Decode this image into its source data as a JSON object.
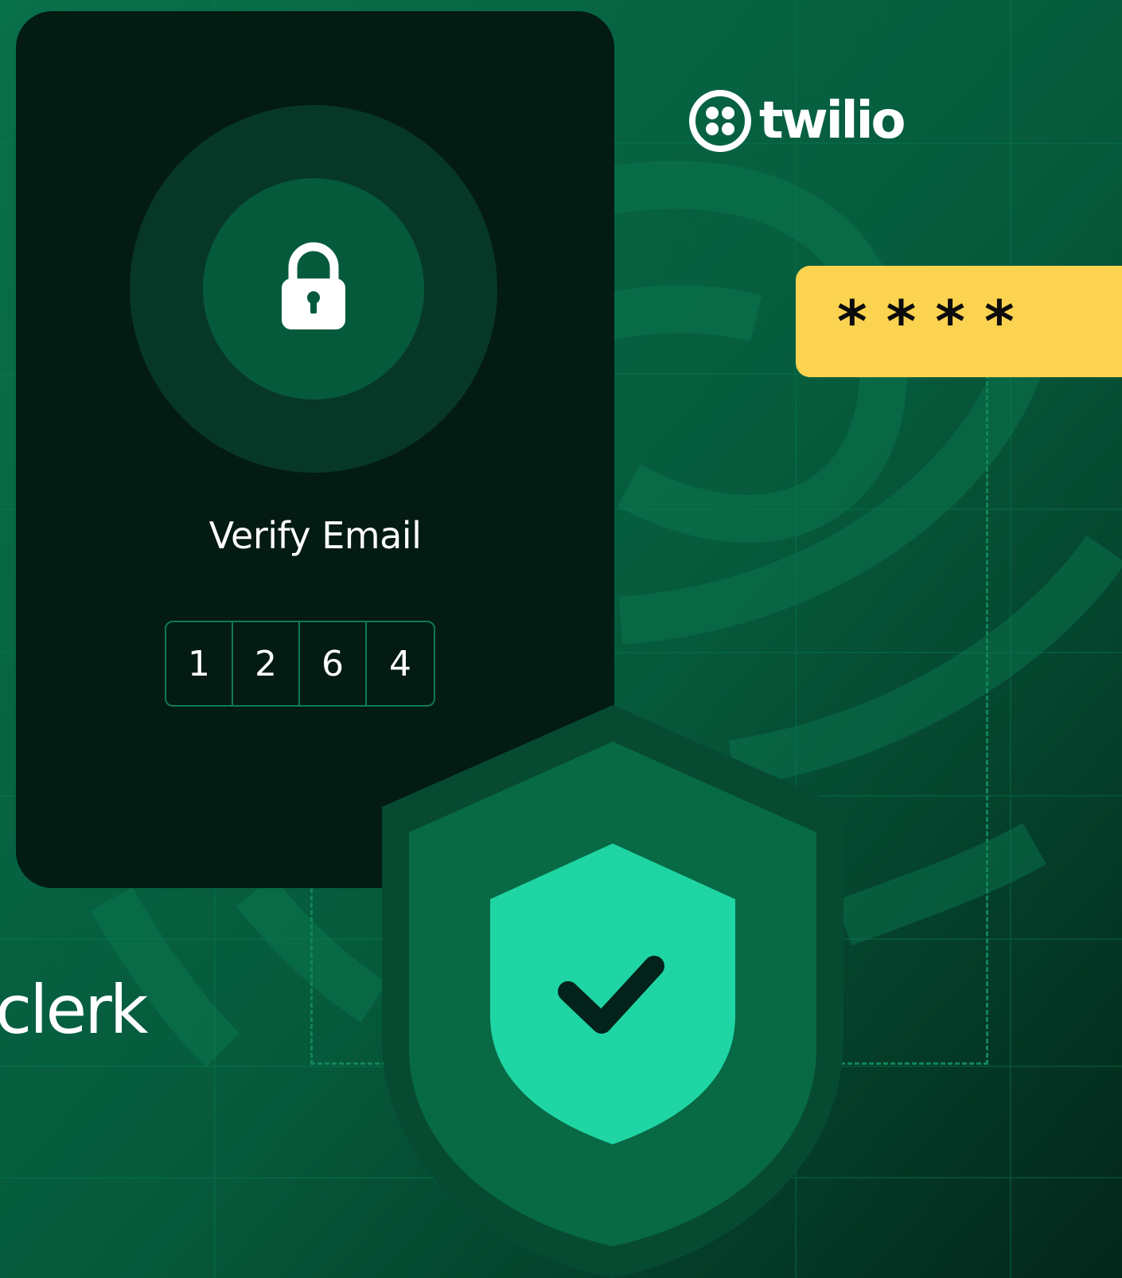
{
  "card": {
    "title": "Verify Email",
    "code_digits": [
      "1",
      "2",
      "6",
      "4"
    ]
  },
  "brands": {
    "twilio": "twilio",
    "clerk": "clerk"
  },
  "password_field": {
    "masked_value": "****"
  },
  "icons": {
    "lock": "lock-icon",
    "twilio_logo": "twilio-logo-icon",
    "shield": "shield-check-icon"
  },
  "colors": {
    "background": "#064f36",
    "card": "#031b12",
    "accent_mint": "#1fd5a4",
    "password_yellow": "#fbd350"
  }
}
